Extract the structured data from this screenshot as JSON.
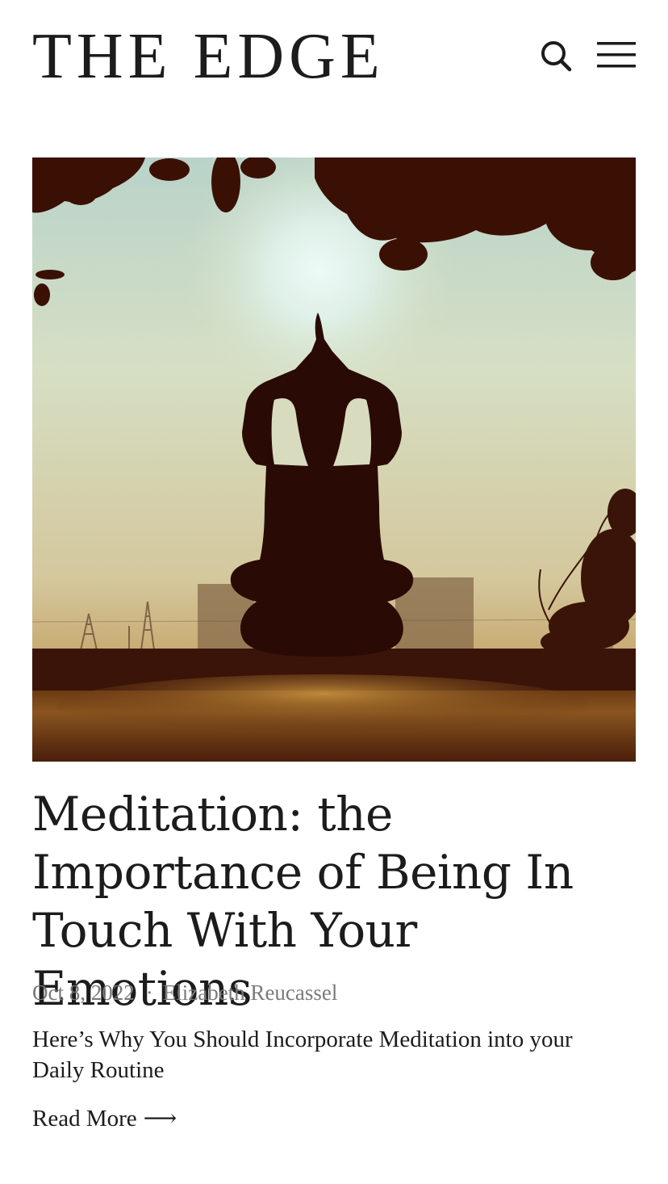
{
  "site": {
    "title": "THE EDGE"
  },
  "header": {
    "search_icon": "search-icon",
    "menu_icon": "hamburger-menu-icon"
  },
  "article": {
    "image_description_icon": "meditation-silhouette-image",
    "title": "Meditation: the Importance of Being In Touch With Your Emotions",
    "date": "Oct 8, 2022",
    "separator": "·",
    "author": "Elizabeth Reucassel",
    "excerpt": "Here’s Why You Should Incorporate Meditation into your Daily Routine",
    "read_more": "Read More",
    "read_more_arrow": "⟶"
  },
  "colors": {
    "text": "#1c1c1c",
    "meta": "#7a7a7a",
    "background": "#ffffff"
  }
}
